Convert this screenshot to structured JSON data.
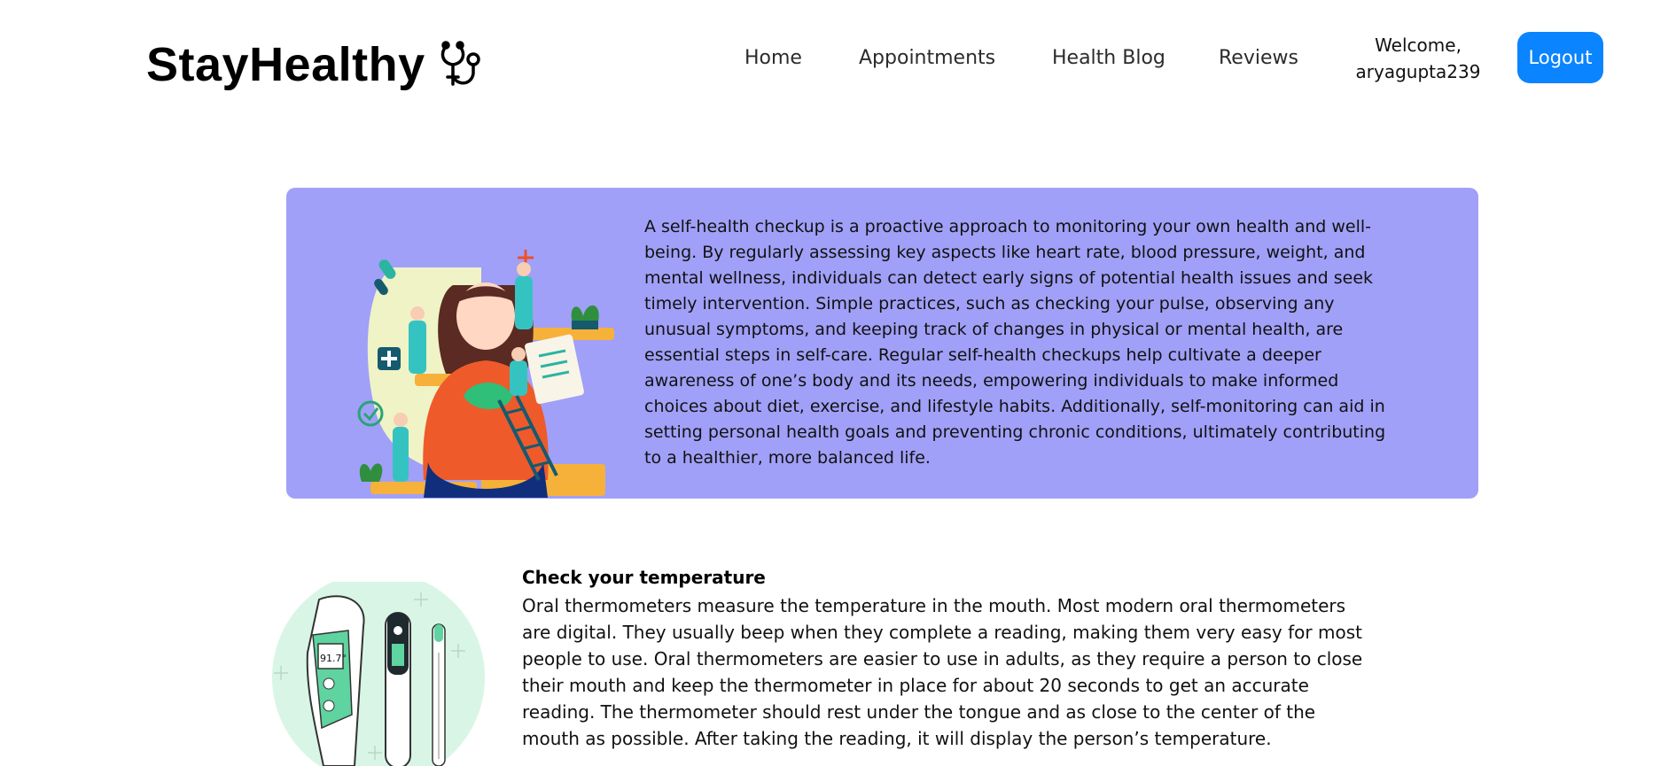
{
  "header": {
    "brand": "StayHealthy",
    "brand_icon": "stethoscope-icon",
    "nav": [
      {
        "id": "home",
        "label": "Home"
      },
      {
        "id": "appointments",
        "label": "Appointments"
      },
      {
        "id": "health_blog",
        "label": "Health Blog"
      },
      {
        "id": "reviews",
        "label": "Reviews"
      }
    ],
    "welcome_line1": "Welcome,",
    "welcome_line2": "aryagupta239",
    "logout_label": "Logout"
  },
  "hero": {
    "text": "A self-health checkup is a proactive approach to monitoring your own health and well-being. By regularly assessing key aspects like heart rate, blood pressure, weight, and mental wellness, individuals can detect early signs of potential health issues and seek timely intervention. Simple practices, such as checking your pulse, observing any unusual symptoms, and keeping track of changes in physical or mental health, are essential steps in self-care. Regular self-health checkups help cultivate a deeper awareness of one’s body and its needs, empowering individuals to make informed choices about diet, exercise, and lifestyle habits. Additionally, self-monitoring can aid in setting personal health goals and preventing chronic conditions, ultimately contributing to a healthier, more balanced life.",
    "illustration": "self-checkup-illustration"
  },
  "temperature": {
    "title": "Check your temperature",
    "text": "Oral thermometers measure the temperature in the mouth. Most modern oral thermometers are digital. They usually beep when they complete a reading, making them very easy for most people to use. Oral thermometers are easier to use in adults, as they require a person to close their mouth and keep the thermometer in place for about 20 seconds to get an accurate reading. The thermometer should rest under the tongue and as close to the center of the mouth as possible. After taking the reading, it will display the person’s temperature.",
    "illustration": "thermometers-illustration",
    "display_reading": "91.7°"
  },
  "colors": {
    "card_bg": "#a0a0f8",
    "logout_bg": "#0a84ff",
    "mint": "#d9f5e6"
  }
}
